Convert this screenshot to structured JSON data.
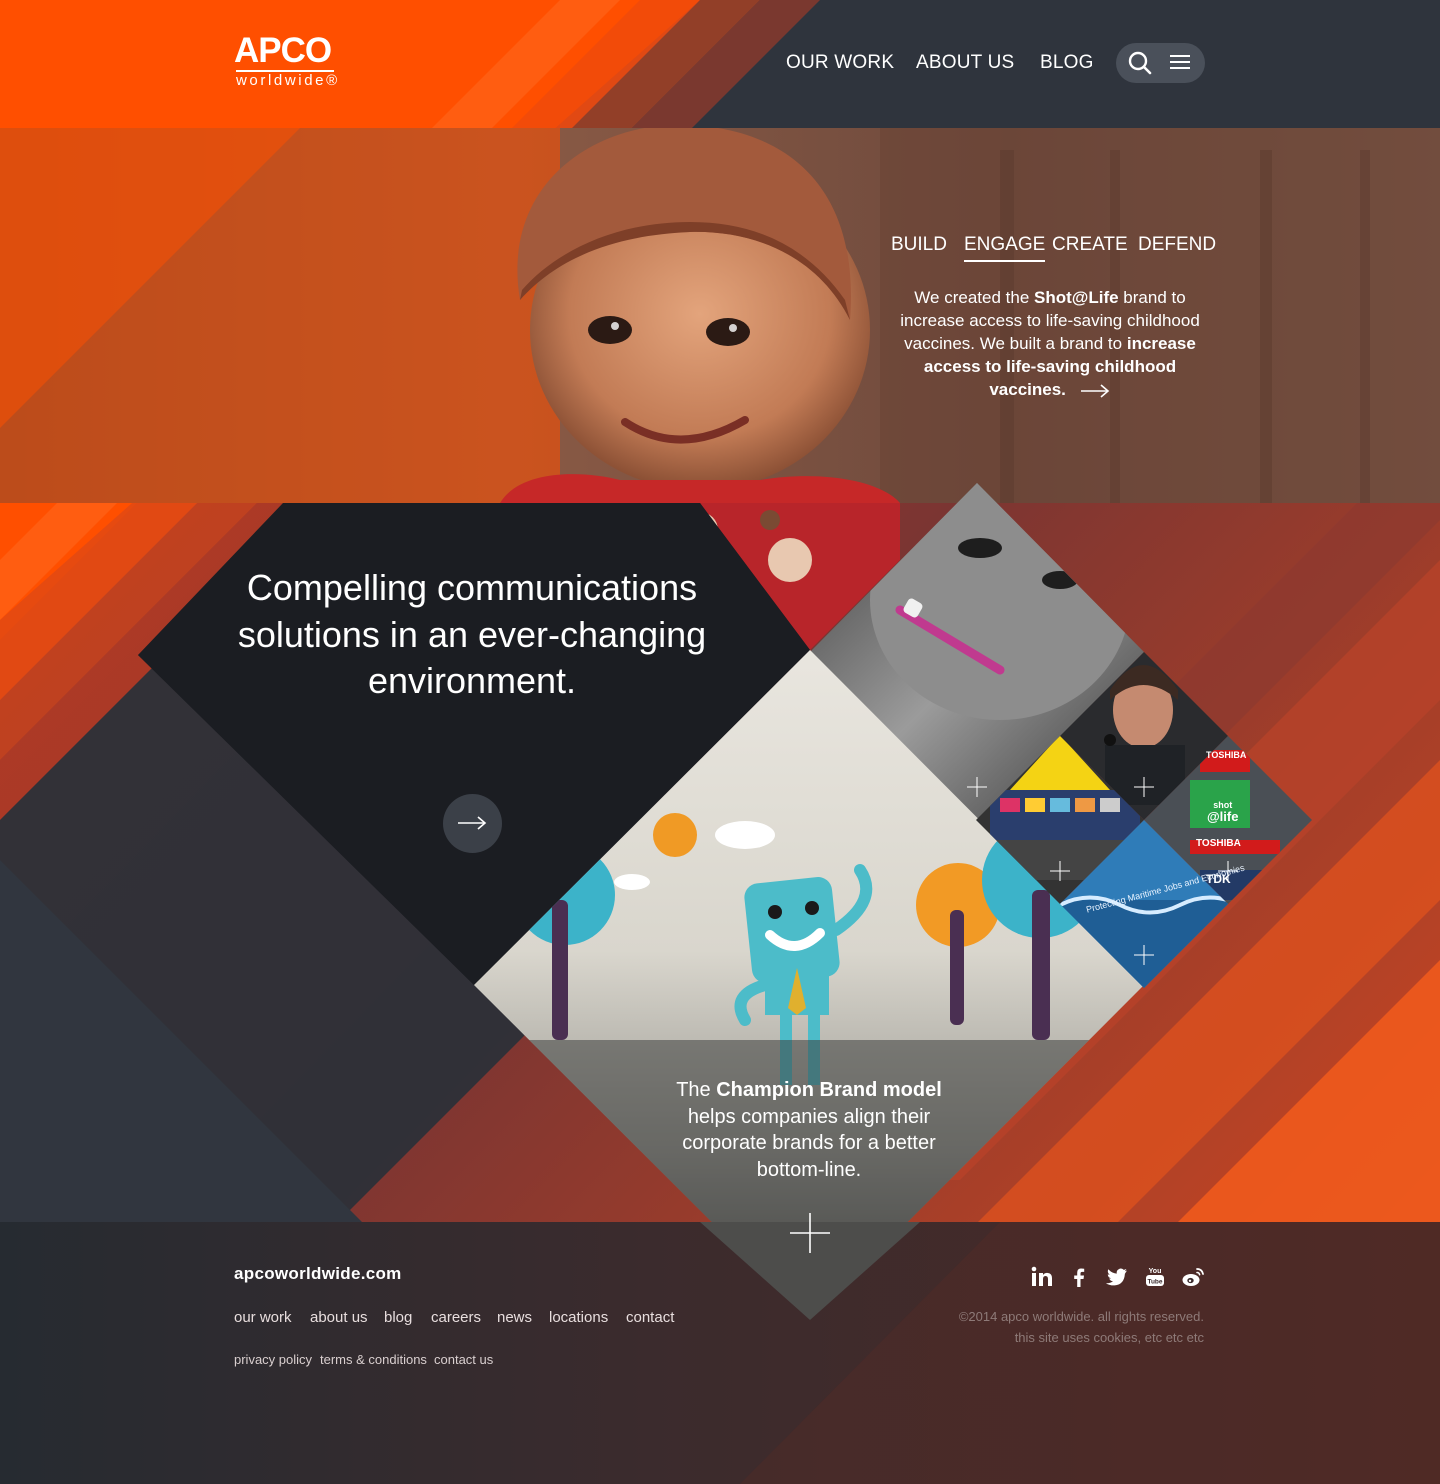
{
  "logo": {
    "main": "APCO",
    "sub": "worldwide®"
  },
  "nav": {
    "items": [
      "OUR WORK",
      "ABOUT US",
      "BLOG"
    ]
  },
  "hero": {
    "tabs": [
      "BUILD",
      "ENGAGE",
      "CREATE",
      "DEFEND"
    ],
    "active_tab": "ENGAGE",
    "copy": {
      "p1": "We created the ",
      "b1": "Shot@Life",
      "p2": " brand to increase access to life-saving childhood vaccines. We built a brand to ",
      "b2": "increase access to life-saving childhood vaccines."
    }
  },
  "headline": "Compelling communications solutions in an ever-changing environment.",
  "champion": {
    "p1": "The ",
    "b1": "Champion Brand model",
    "p2": " helps companies align their corporate brands for  a better bottom-line."
  },
  "tiles": {
    "infographic_title": "Protecting Maritime Jobs and Economies",
    "shot_sign_line1": "shot",
    "shot_sign_line2": "@life",
    "toshiba": "TOSHIBA",
    "tdk": "TDK"
  },
  "footer": {
    "domain": "apcoworldwide.com",
    "links": [
      "our work",
      "about us",
      "blog",
      "careers",
      "news",
      "locations",
      "contact"
    ],
    "sub_links": [
      "privacy policy",
      "terms & conditions",
      "contact us"
    ],
    "copyright": "©2014 apco worldwide. all rights reserved.",
    "cookies": "this site uses cookies, etc etc etc",
    "social": [
      "linkedin-icon",
      "facebook-icon",
      "twitter-icon",
      "youtube-icon",
      "weibo-icon"
    ]
  },
  "colors": {
    "brand_orange": "#ff4f00",
    "header_dark": "#2f343d",
    "diamond_dark": "#1b1d22",
    "footer_dark": "#3a2a2c"
  }
}
